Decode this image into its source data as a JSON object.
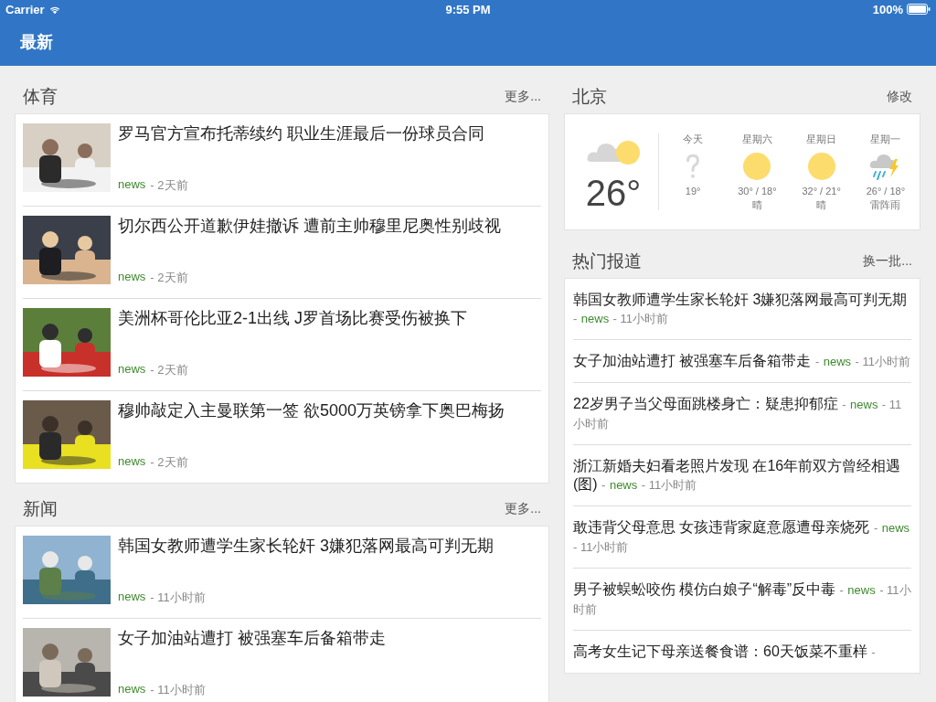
{
  "status_bar": {
    "carrier": "Carrier",
    "time": "9:55 PM",
    "battery": "100%"
  },
  "nav": {
    "title": "最新"
  },
  "sections": [
    {
      "title": "体育",
      "more": "更多...",
      "items": [
        {
          "title": "罗马官方宣布托蒂续约 职业生涯最后一份球员合同",
          "source": "news",
          "time": "- 2天前"
        },
        {
          "title": "切尔西公开道歉伊娃撤诉 遭前主帅穆里尼奥性别歧视",
          "source": "news",
          "time": "- 2天前"
        },
        {
          "title": "美洲杯哥伦比亚2-1出线 J罗首场比赛受伤被换下",
          "source": "news",
          "time": "- 2天前"
        },
        {
          "title": "穆帅敲定入主曼联第一签 欲5000万英镑拿下奥巴梅扬",
          "source": "news",
          "time": "- 2天前"
        }
      ]
    },
    {
      "title": "新闻",
      "more": "更多...",
      "items": [
        {
          "title": "韩国女教师遭学生家长轮奸 3嫌犯落网最高可判无期",
          "source": "news",
          "time": "- 11小时前"
        },
        {
          "title": "女子加油站遭打 被强塞车后备箱带走",
          "source": "news",
          "time": "- 11小时前"
        }
      ]
    }
  ],
  "weather": {
    "city": "北京",
    "edit": "修改",
    "current": {
      "kind": "partly_cloudy",
      "temp": "26°"
    },
    "days": [
      {
        "day": "今天",
        "kind": "unknown",
        "temps": "19°"
      },
      {
        "day": "星期六",
        "kind": "sunny",
        "temps": "30° / 18°",
        "desc": "晴"
      },
      {
        "day": "星期日",
        "kind": "sunny",
        "temps": "32° / 21°",
        "desc": "晴"
      },
      {
        "day": "星期一",
        "kind": "thunderstorm",
        "temps": "26° / 18°",
        "desc": "雷阵雨"
      }
    ]
  },
  "hot": {
    "title": "热门报道",
    "refresh": "换一批...",
    "items": [
      {
        "title": "韩国女教师遭学生家长轮奸 3嫌犯落网最高可判无期",
        "dash": "-",
        "source": "news",
        "time": "- 11小时前"
      },
      {
        "title": "女子加油站遭打 被强塞车后备箱带走",
        "dash": "-",
        "source": "news",
        "time": "- 11小时前"
      },
      {
        "title": "22岁男子当父母面跳楼身亡：疑患抑郁症",
        "dash": "-",
        "source": "news",
        "time": "- 11小时前"
      },
      {
        "title": "浙江新婚夫妇看老照片发现 在16年前双方曾经相遇(图)",
        "dash": "-",
        "source": "news",
        "time": "- 11小时前"
      },
      {
        "title": "敢违背父母意思 女孩违背家庭意愿遭母亲烧死",
        "dash": "-",
        "source": "news",
        "time": "- 11小时前"
      },
      {
        "title": "男子被蜈蚣咬伤 模仿白娘子“解毒”反中毒",
        "dash": "-",
        "source": "news",
        "time": "- 11小时前"
      },
      {
        "title": "高考女生记下母亲送餐食谱：60天饭菜不重样",
        "dash": "-"
      }
    ]
  }
}
